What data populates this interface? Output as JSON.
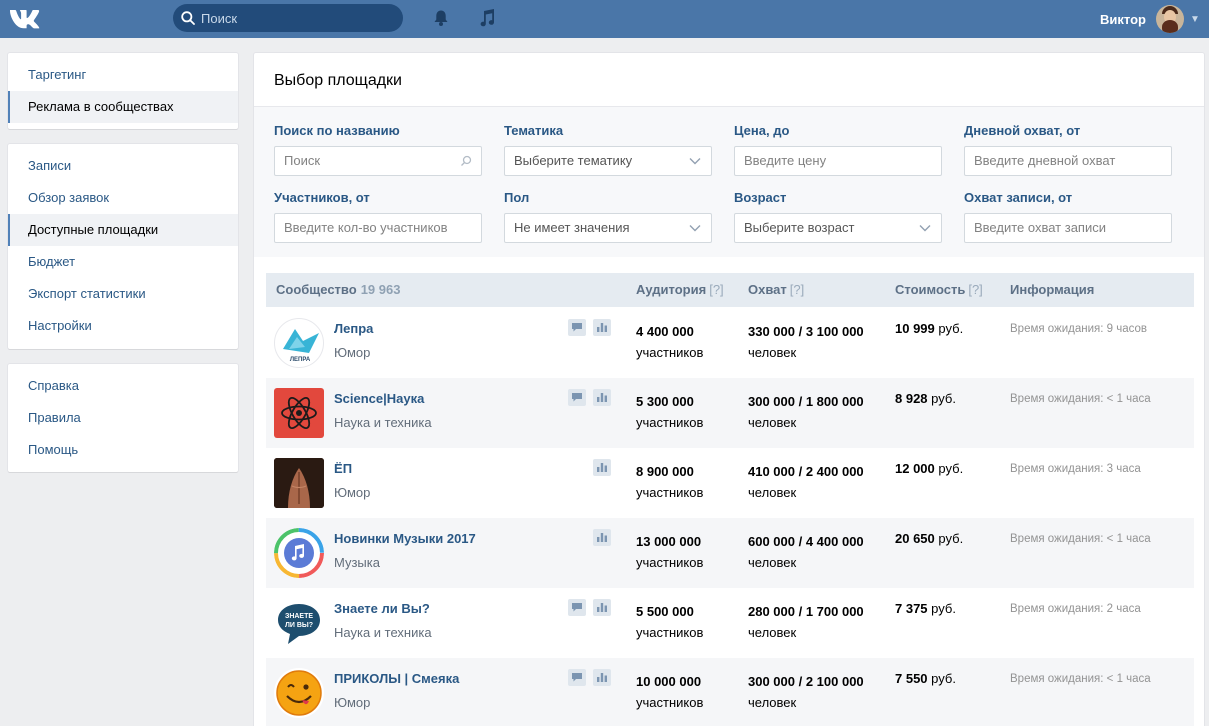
{
  "header": {
    "logo": "VK",
    "search_placeholder": "Поиск",
    "user_name": "Виктор"
  },
  "sidebar": {
    "block1": [
      {
        "label": "Таргетинг"
      },
      {
        "label": "Реклама в сообществах"
      }
    ],
    "block2": [
      {
        "label": "Записи"
      },
      {
        "label": "Обзор заявок"
      },
      {
        "label": "Доступные площадки"
      },
      {
        "label": "Бюджет"
      },
      {
        "label": "Экспорт статистики"
      },
      {
        "label": "Настройки"
      }
    ],
    "block3": [
      {
        "label": "Справка"
      },
      {
        "label": "Правила"
      },
      {
        "label": "Помощь"
      }
    ]
  },
  "main": {
    "title": "Выбор площадки",
    "filters": {
      "name_label": "Поиск по названию",
      "name_placeholder": "Поиск",
      "topic_label": "Тематика",
      "topic_value": "Выберите тематику",
      "price_label": "Цена, до",
      "price_placeholder": "Введите цену",
      "daily_label": "Дневной охват, от",
      "daily_placeholder": "Введите дневной охват",
      "members_label": "Участников, от",
      "members_placeholder": "Введите кол-во участников",
      "gender_label": "Пол",
      "gender_value": "Не имеет значения",
      "age_label": "Возраст",
      "age_value": "Выберите возраст",
      "post_reach_label": "Охват записи, от",
      "post_reach_placeholder": "Введите охват записи"
    },
    "table": {
      "col_community": "Сообщество",
      "community_count": "19 963",
      "col_audience": "Аудитория",
      "col_reach": "Охват",
      "col_cost": "Стоимость",
      "col_info": "Информация",
      "q": "[?]",
      "rows": [
        {
          "name": "Лепра",
          "category": "Юмор",
          "audience": "4 400 000",
          "audience_unit": "участников",
          "reach": "330 000 / 3 100 000",
          "reach_unit": "человек",
          "cost": "10 999",
          "currency": "руб.",
          "info": "Время ожидания: 9 часов"
        },
        {
          "name": "Science|Наука",
          "category": "Наука и техника",
          "audience": "5 300 000",
          "audience_unit": "участников",
          "reach": "300 000 / 1 800 000",
          "reach_unit": "человек",
          "cost": "8 928",
          "currency": "руб.",
          "info": "Время ожидания: < 1 часа"
        },
        {
          "name": "ЁП",
          "category": "Юмор",
          "audience": "8 900 000",
          "audience_unit": "участников",
          "reach": "410 000 / 2 400 000",
          "reach_unit": "человек",
          "cost": "12 000",
          "currency": "руб.",
          "info": "Время ожидания: 3 часа"
        },
        {
          "name": "Новинки Музыки 2017",
          "category": "Музыка",
          "audience": "13 000 000",
          "audience_unit": "участников",
          "reach": "600 000 / 4 400 000",
          "reach_unit": "человек",
          "cost": "20 650",
          "currency": "руб.",
          "info": "Время ожидания: < 1 часа"
        },
        {
          "name": "Знаете ли Вы?",
          "category": "Наука и техника",
          "audience": "5 500 000",
          "audience_unit": "участников",
          "reach": "280 000 / 1 700 000",
          "reach_unit": "человек",
          "cost": "7 375",
          "currency": "руб.",
          "info": "Время ожидания: 2 часа"
        },
        {
          "name": "ПРИКОЛЫ | Смеяка",
          "category": "Юмор",
          "audience": "10 000 000",
          "audience_unit": "участников",
          "reach": "300 000 / 2 100 000",
          "reach_unit": "человек",
          "cost": "7 550",
          "currency": "руб.",
          "info": "Время ожидания: < 1 часа"
        }
      ]
    },
    "avatar_texts": {
      "lepra": "ЛЕПРА",
      "znaete_line1": "ЗНАЕТЕ",
      "znaete_line2": "ЛИ ВЫ?"
    }
  },
  "colors": {
    "header_bg": "#4a76a8",
    "link": "#2a5885",
    "table_head_bg": "#e5ebf1"
  }
}
